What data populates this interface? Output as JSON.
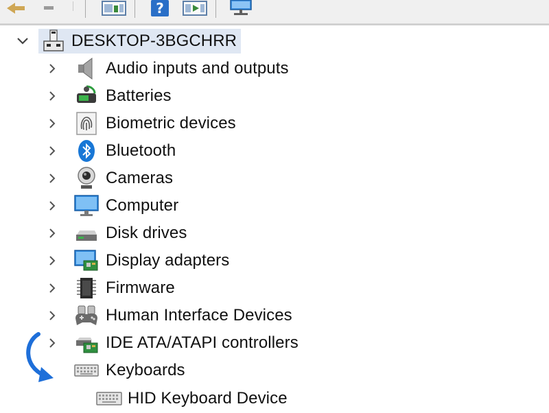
{
  "toolbar": {
    "buttons": [
      "back-icon",
      "forward-icon",
      "properties-icon",
      "help-icon",
      "action-icon",
      "scan-icon"
    ]
  },
  "tree": {
    "root": {
      "label": "DESKTOP-3BGCHRR",
      "icon": "computer-tower-icon",
      "expanded": true
    },
    "categories": [
      {
        "label": "Audio inputs and outputs",
        "icon": "speaker-icon",
        "expanded": false
      },
      {
        "label": "Batteries",
        "icon": "battery-icon",
        "expanded": false
      },
      {
        "label": "Biometric devices",
        "icon": "fingerprint-icon",
        "expanded": false
      },
      {
        "label": "Bluetooth",
        "icon": "bluetooth-icon",
        "expanded": false
      },
      {
        "label": "Cameras",
        "icon": "webcam-icon",
        "expanded": false
      },
      {
        "label": "Computer",
        "icon": "monitor-icon",
        "expanded": false
      },
      {
        "label": "Disk drives",
        "icon": "disk-drive-icon",
        "expanded": false
      },
      {
        "label": "Display adapters",
        "icon": "display-adapter-icon",
        "expanded": false
      },
      {
        "label": "Firmware",
        "icon": "chip-icon",
        "expanded": false
      },
      {
        "label": "Human Interface Devices",
        "icon": "gamepad-icon",
        "expanded": false
      },
      {
        "label": "IDE ATA/ATAPI controllers",
        "icon": "controller-card-icon",
        "expanded": false
      },
      {
        "label": "Keyboards",
        "icon": "keyboard-icon",
        "expanded": true
      }
    ],
    "keyboard_children": [
      {
        "label": "HID Keyboard Device",
        "icon": "keyboard-icon"
      }
    ]
  },
  "annotation": {
    "icon": "curved-arrow-icon",
    "color": "#1e6fd9"
  },
  "colors": {
    "selection": "#dfe7f3",
    "text": "#111111",
    "chevron": "#555555"
  }
}
